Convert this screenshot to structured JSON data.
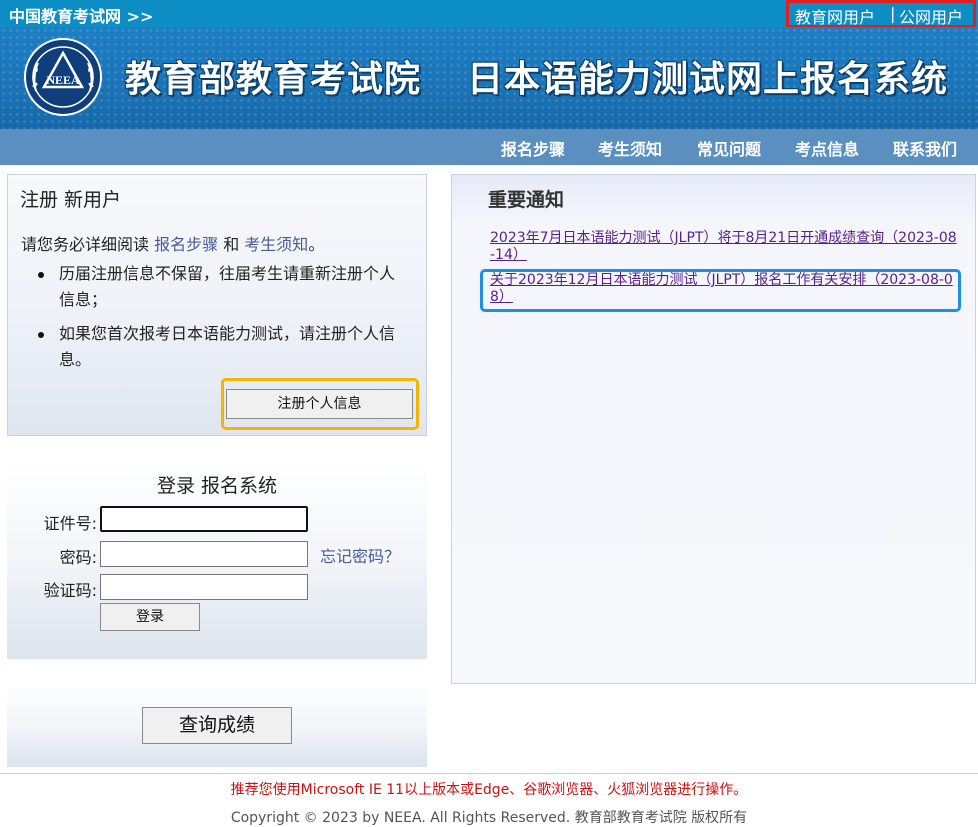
{
  "topbar": {
    "site_link": "中国教育考试网 >>",
    "user_edu": "教育网用户",
    "separator": "|",
    "user_public": "公网用户"
  },
  "banner": {
    "logo_text": "NEEA",
    "title_org": "教育部教育考试院",
    "title_system": "日本语能力测试网上报名系统"
  },
  "nav": {
    "items": [
      "报名步骤",
      "考生须知",
      "常见问题",
      "考点信息",
      "联系我们"
    ]
  },
  "register": {
    "title": "注册 新用户",
    "intro_prefix": "请您务必详细阅读 ",
    "link_steps": "报名步骤",
    "intro_and": " 和 ",
    "link_notice": "考生须知",
    "intro_suffix": "。",
    "bullets": [
      "历届注册信息不保留，往届考生请重新注册个人信息；",
      "如果您首次报考日本语能力测试，请注册个人信息。"
    ],
    "button": "注册个人信息"
  },
  "login": {
    "title": "登录 报名系统",
    "id_label": "证件号:",
    "id_value": "",
    "password_label": "密码:",
    "password_value": "",
    "captcha_label": "验证码:",
    "captcha_value": "",
    "forgot": "忘记密码？",
    "button": "登录"
  },
  "score": {
    "button": "查询成绩"
  },
  "notice": {
    "title": "重要通知",
    "items": [
      "2023年7月日本语能力测试（JLPT）将于8月21日开通成绩查询（2023-08-14）",
      "关于2023年12月日本语能力测试（JLPT）报名工作有关安排（2023-08-08）"
    ]
  },
  "footer": {
    "tip": "推荐您使用Microsoft IE 11以上版本或Edge、谷歌浏览器、火狐浏览器进行操作。",
    "copyright": "Copyright © 2023 by NEEA. All Rights Reserved. 教育部教育考试院 版权所有"
  },
  "colors": {
    "topbar": "#0c8ec4",
    "banner": "#1e7fc4",
    "navbar": "#5b8fc0",
    "tip_red": "#cc1111",
    "link_purple": "#5a1e8c",
    "highlight_red": "#e02020",
    "highlight_yellow": "#f4b400",
    "highlight_blue": "#1f8fe6"
  }
}
